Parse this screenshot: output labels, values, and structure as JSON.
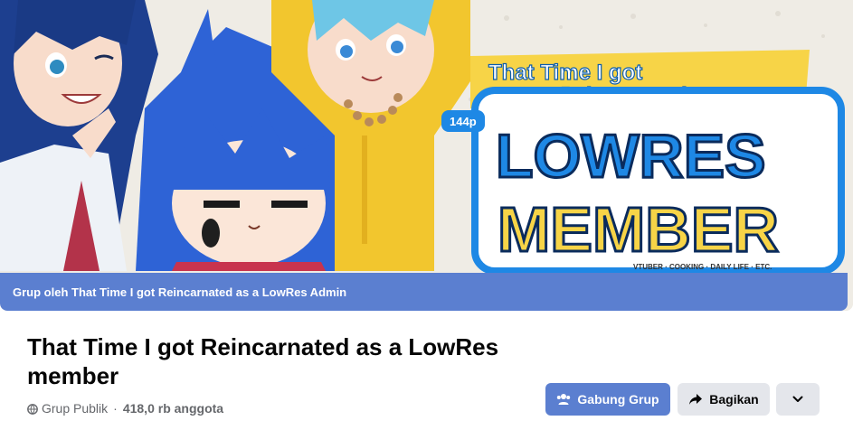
{
  "cover": {
    "banner_line1": "That Time I got",
    "banner_line2": "Reincarnated as a",
    "badge": "144p",
    "big_line1": "LOWRES",
    "big_line2": "MEMBER",
    "footer_tags": "VTUBER · COOKING · DAILY LIFE · ETC."
  },
  "owner_bar": {
    "text": "Grup oleh That Time I got Reincarnated as a LowRes Admin"
  },
  "group": {
    "title": "That Time I got Reincarnated as a LowRes member",
    "privacy": "Grup Publik",
    "separator": "·",
    "members": "418,0 rb anggota"
  },
  "actions": {
    "join_label": "Gabung Grup",
    "share_label": "Bagikan"
  },
  "icons": {
    "globe": "globe-icon",
    "join": "people-icon",
    "share": "share-arrow-icon",
    "more": "chevron-down-icon"
  },
  "colors": {
    "accent": "#5b7fd0",
    "secondary_button": "#e4e6eb",
    "banner_yellow": "#f7d447",
    "banner_blue": "#1e88e5"
  }
}
